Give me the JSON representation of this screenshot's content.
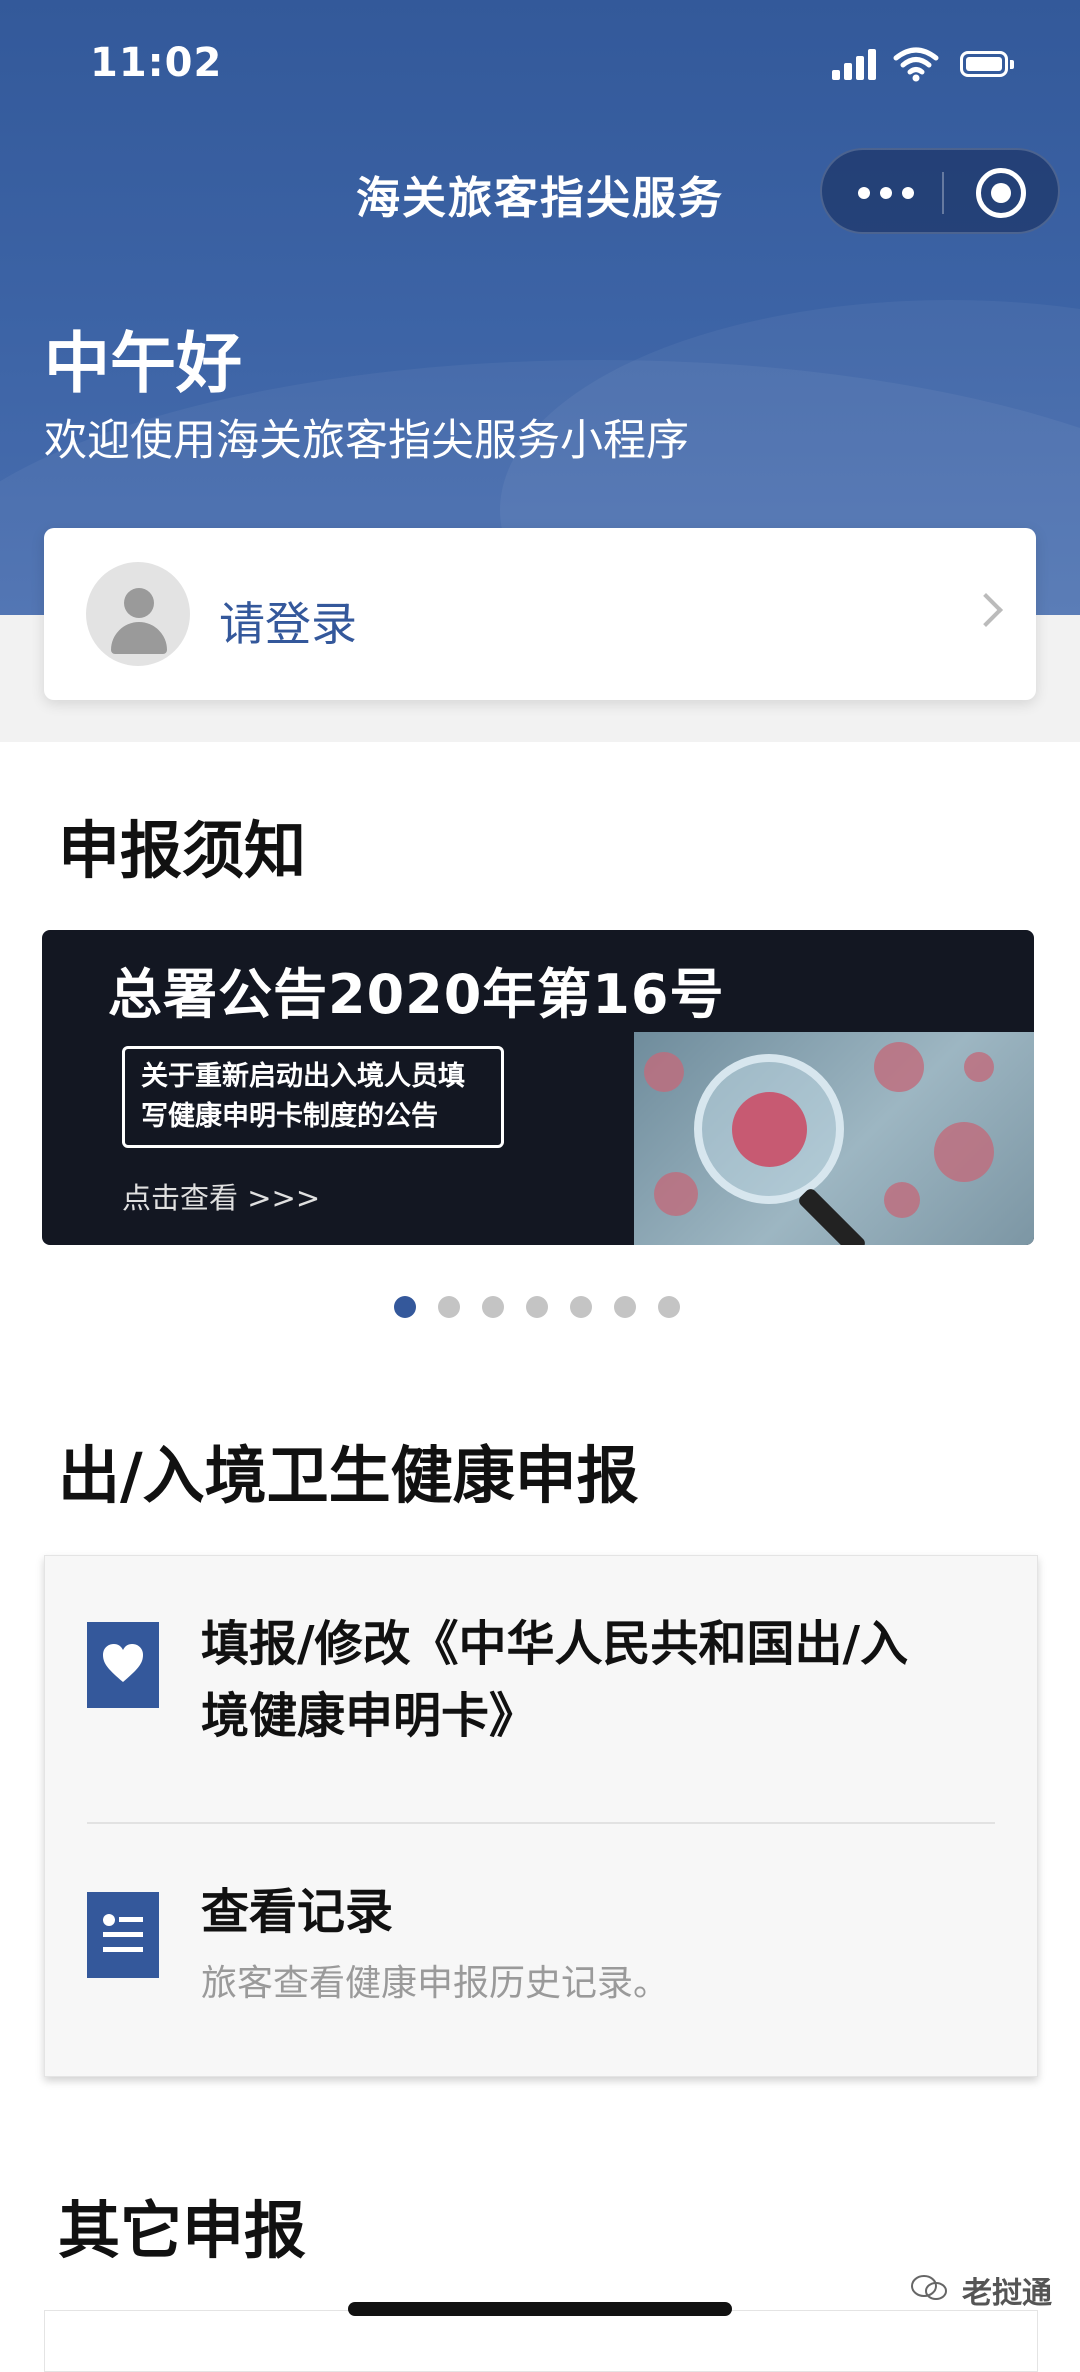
{
  "status_bar": {
    "time": "11:02"
  },
  "nav": {
    "title": "海关旅客指尖服务"
  },
  "hero": {
    "greeting": "中午好",
    "welcome": "欢迎使用海关旅客指尖服务小程序"
  },
  "login": {
    "label": "请登录"
  },
  "notice": {
    "section_title": "申报须知",
    "banner": {
      "title": "总署公告2020年第16号",
      "box_line1": "关于重新启动出入境人员填",
      "box_line2": "写健康申明卡制度的公告",
      "cta": "点击查看 >>>"
    },
    "carousel": {
      "total": 7,
      "active_index": 0
    }
  },
  "health": {
    "section_title": "出/入境卫生健康申报",
    "items": [
      {
        "title_line1": "填报/修改《中华人民共和国出/入",
        "title_line2": "境健康申明卡》",
        "icon": "heart-icon"
      },
      {
        "title": "查看记录",
        "subtitle": "旅客查看健康申报历史记录。",
        "icon": "record-list-icon"
      }
    ]
  },
  "other": {
    "section_title": "其它申报"
  },
  "watermark": {
    "text": "老挝通"
  },
  "colors": {
    "primary": "#34589b",
    "header": "#3d64a6"
  }
}
